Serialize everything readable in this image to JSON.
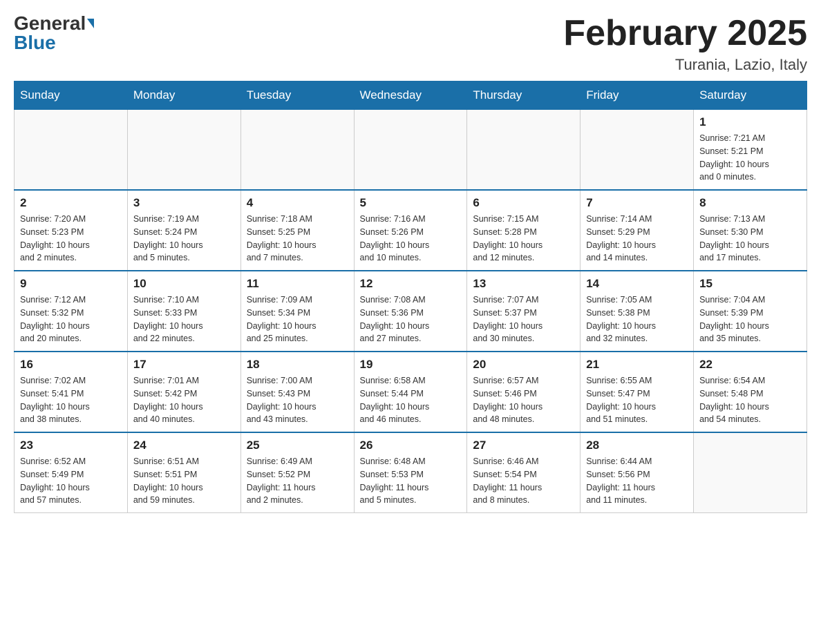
{
  "header": {
    "logo_general": "General",
    "logo_blue": "Blue",
    "month_title": "February 2025",
    "location": "Turania, Lazio, Italy"
  },
  "weekdays": [
    "Sunday",
    "Monday",
    "Tuesday",
    "Wednesday",
    "Thursday",
    "Friday",
    "Saturday"
  ],
  "weeks": [
    [
      {
        "day": "",
        "info": ""
      },
      {
        "day": "",
        "info": ""
      },
      {
        "day": "",
        "info": ""
      },
      {
        "day": "",
        "info": ""
      },
      {
        "day": "",
        "info": ""
      },
      {
        "day": "",
        "info": ""
      },
      {
        "day": "1",
        "info": "Sunrise: 7:21 AM\nSunset: 5:21 PM\nDaylight: 10 hours\nand 0 minutes."
      }
    ],
    [
      {
        "day": "2",
        "info": "Sunrise: 7:20 AM\nSunset: 5:23 PM\nDaylight: 10 hours\nand 2 minutes."
      },
      {
        "day": "3",
        "info": "Sunrise: 7:19 AM\nSunset: 5:24 PM\nDaylight: 10 hours\nand 5 minutes."
      },
      {
        "day": "4",
        "info": "Sunrise: 7:18 AM\nSunset: 5:25 PM\nDaylight: 10 hours\nand 7 minutes."
      },
      {
        "day": "5",
        "info": "Sunrise: 7:16 AM\nSunset: 5:26 PM\nDaylight: 10 hours\nand 10 minutes."
      },
      {
        "day": "6",
        "info": "Sunrise: 7:15 AM\nSunset: 5:28 PM\nDaylight: 10 hours\nand 12 minutes."
      },
      {
        "day": "7",
        "info": "Sunrise: 7:14 AM\nSunset: 5:29 PM\nDaylight: 10 hours\nand 14 minutes."
      },
      {
        "day": "8",
        "info": "Sunrise: 7:13 AM\nSunset: 5:30 PM\nDaylight: 10 hours\nand 17 minutes."
      }
    ],
    [
      {
        "day": "9",
        "info": "Sunrise: 7:12 AM\nSunset: 5:32 PM\nDaylight: 10 hours\nand 20 minutes."
      },
      {
        "day": "10",
        "info": "Sunrise: 7:10 AM\nSunset: 5:33 PM\nDaylight: 10 hours\nand 22 minutes."
      },
      {
        "day": "11",
        "info": "Sunrise: 7:09 AM\nSunset: 5:34 PM\nDaylight: 10 hours\nand 25 minutes."
      },
      {
        "day": "12",
        "info": "Sunrise: 7:08 AM\nSunset: 5:36 PM\nDaylight: 10 hours\nand 27 minutes."
      },
      {
        "day": "13",
        "info": "Sunrise: 7:07 AM\nSunset: 5:37 PM\nDaylight: 10 hours\nand 30 minutes."
      },
      {
        "day": "14",
        "info": "Sunrise: 7:05 AM\nSunset: 5:38 PM\nDaylight: 10 hours\nand 32 minutes."
      },
      {
        "day": "15",
        "info": "Sunrise: 7:04 AM\nSunset: 5:39 PM\nDaylight: 10 hours\nand 35 minutes."
      }
    ],
    [
      {
        "day": "16",
        "info": "Sunrise: 7:02 AM\nSunset: 5:41 PM\nDaylight: 10 hours\nand 38 minutes."
      },
      {
        "day": "17",
        "info": "Sunrise: 7:01 AM\nSunset: 5:42 PM\nDaylight: 10 hours\nand 40 minutes."
      },
      {
        "day": "18",
        "info": "Sunrise: 7:00 AM\nSunset: 5:43 PM\nDaylight: 10 hours\nand 43 minutes."
      },
      {
        "day": "19",
        "info": "Sunrise: 6:58 AM\nSunset: 5:44 PM\nDaylight: 10 hours\nand 46 minutes."
      },
      {
        "day": "20",
        "info": "Sunrise: 6:57 AM\nSunset: 5:46 PM\nDaylight: 10 hours\nand 48 minutes."
      },
      {
        "day": "21",
        "info": "Sunrise: 6:55 AM\nSunset: 5:47 PM\nDaylight: 10 hours\nand 51 minutes."
      },
      {
        "day": "22",
        "info": "Sunrise: 6:54 AM\nSunset: 5:48 PM\nDaylight: 10 hours\nand 54 minutes."
      }
    ],
    [
      {
        "day": "23",
        "info": "Sunrise: 6:52 AM\nSunset: 5:49 PM\nDaylight: 10 hours\nand 57 minutes."
      },
      {
        "day": "24",
        "info": "Sunrise: 6:51 AM\nSunset: 5:51 PM\nDaylight: 10 hours\nand 59 minutes."
      },
      {
        "day": "25",
        "info": "Sunrise: 6:49 AM\nSunset: 5:52 PM\nDaylight: 11 hours\nand 2 minutes."
      },
      {
        "day": "26",
        "info": "Sunrise: 6:48 AM\nSunset: 5:53 PM\nDaylight: 11 hours\nand 5 minutes."
      },
      {
        "day": "27",
        "info": "Sunrise: 6:46 AM\nSunset: 5:54 PM\nDaylight: 11 hours\nand 8 minutes."
      },
      {
        "day": "28",
        "info": "Sunrise: 6:44 AM\nSunset: 5:56 PM\nDaylight: 11 hours\nand 11 minutes."
      },
      {
        "day": "",
        "info": ""
      }
    ]
  ]
}
